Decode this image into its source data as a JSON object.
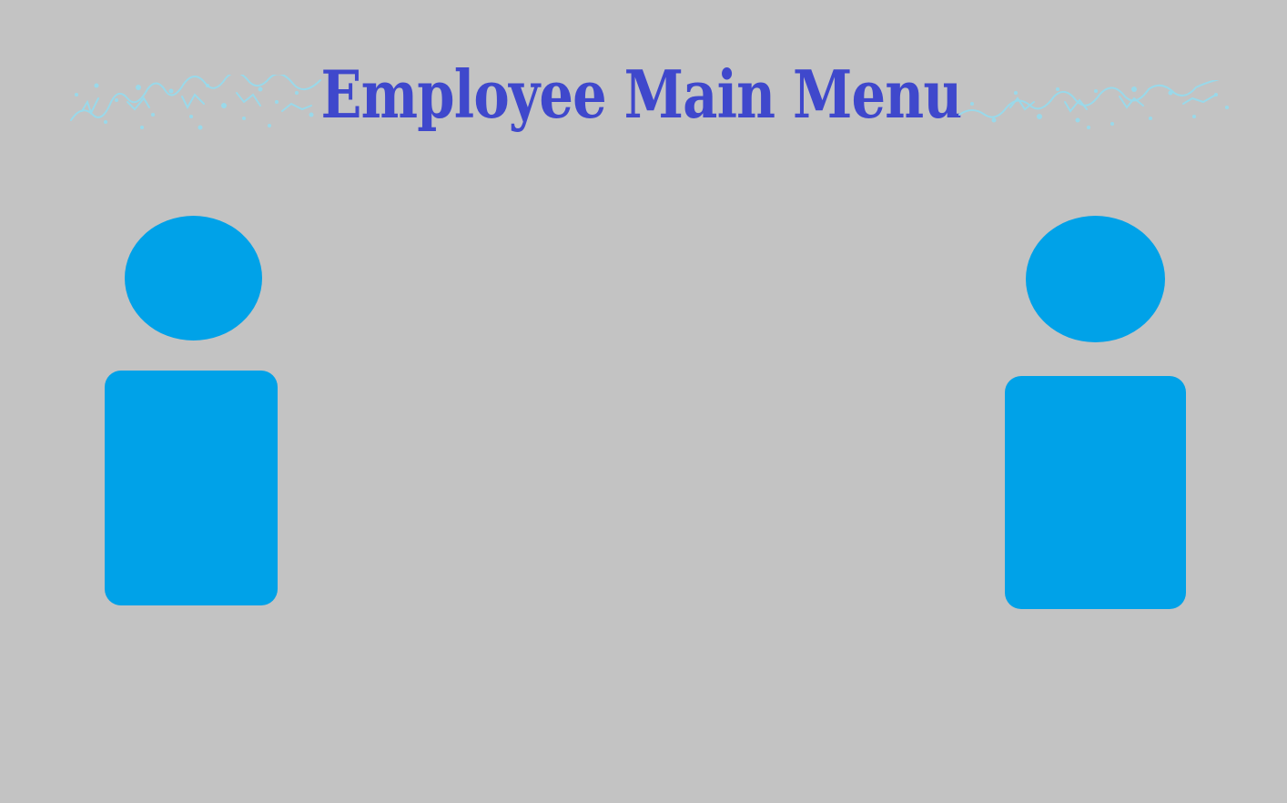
{
  "window": {
    "title": "Employee Main Menu",
    "background_color": "#c3c3c3",
    "title_color": "#3f48cc",
    "accent_color": "#00a2e8",
    "decoration_color": "#99d9ea"
  },
  "decorations": {
    "left": "sparkle-decoration",
    "right": "sparkle-decoration"
  },
  "menu_buttons": [
    {
      "icon": "person-icon",
      "color": "#00a2e8"
    },
    {
      "icon": "person-icon",
      "color": "#00a2e8"
    }
  ]
}
